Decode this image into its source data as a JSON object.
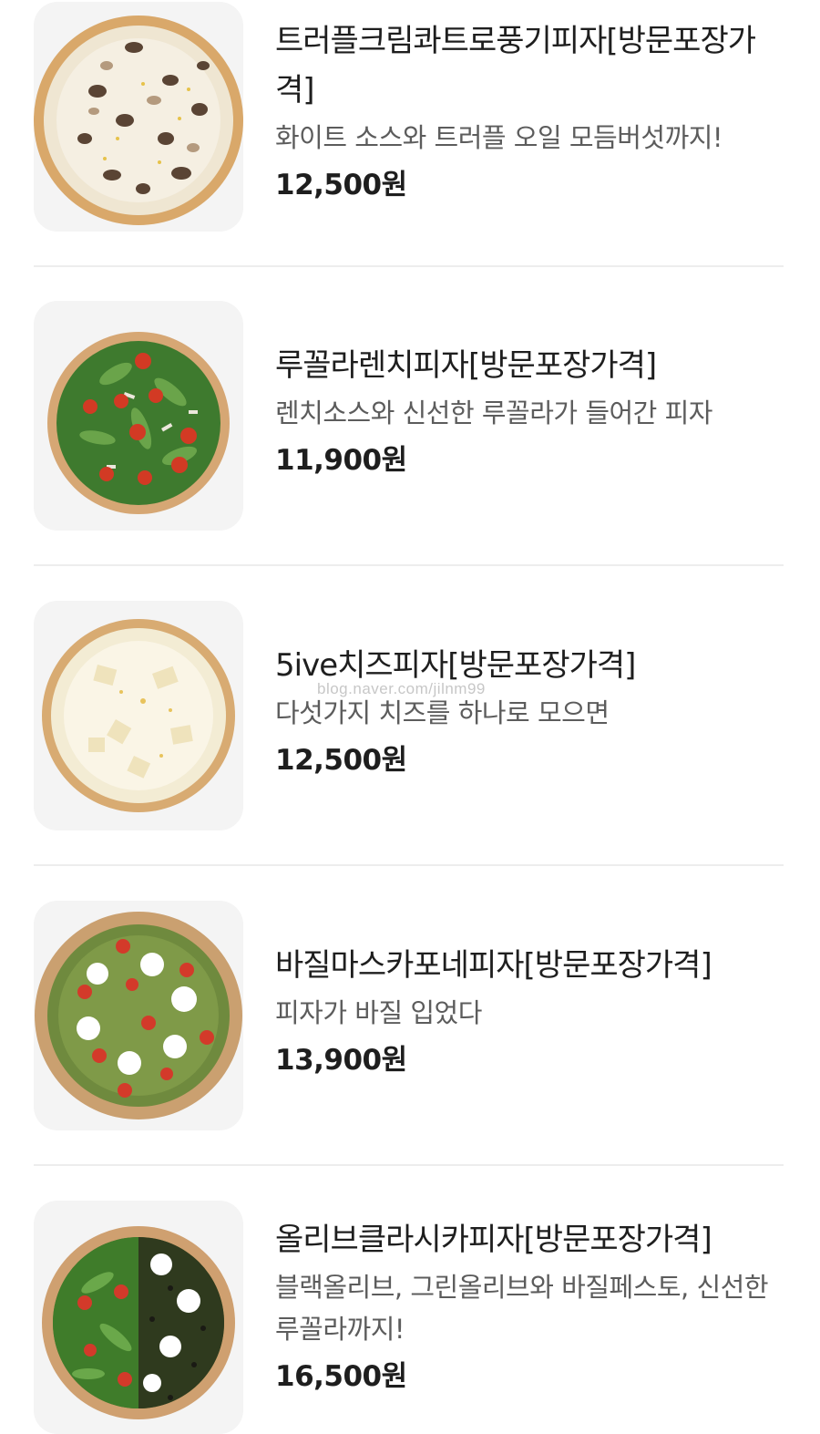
{
  "menu": {
    "items": [
      {
        "name": "트러플크림콰트로풍기피자[방문포장가격]",
        "description": "화이트 소스와 트러플 오일 모듬버섯까지!",
        "price": "12,500원",
        "image_icon": "truffle-mushroom-pizza-image"
      },
      {
        "name": "루꼴라렌치피자[방문포장가격]",
        "description": "렌치소스와 신선한 루꼴라가 들어간 피자",
        "price": "11,900원",
        "image_icon": "arugula-ranch-pizza-image"
      },
      {
        "name": "5ive치즈피자[방문포장가격]",
        "description": "다섯가지 치즈를 하나로 모으면",
        "price": "12,500원",
        "image_icon": "five-cheese-pizza-image"
      },
      {
        "name": "바질마스카포네피자[방문포장가격]",
        "description": "피자가 바질 입었다",
        "price": "13,900원",
        "image_icon": "basil-mascarpone-pizza-image"
      },
      {
        "name": "올리브클라시카피자[방문포장가격]",
        "description": "블랙올리브, 그린올리브와 바질페스토, 신선한 루꼴라까지!",
        "price": "16,500원",
        "image_icon": "olive-classica-pizza-image"
      }
    ]
  },
  "watermark": "blog.naver.com/jilnm99",
  "colors": {
    "text": "#1e1e1e",
    "description": "#5c5c5c",
    "thumb_bg": "#f4f4f4",
    "divider": "#ededed"
  }
}
